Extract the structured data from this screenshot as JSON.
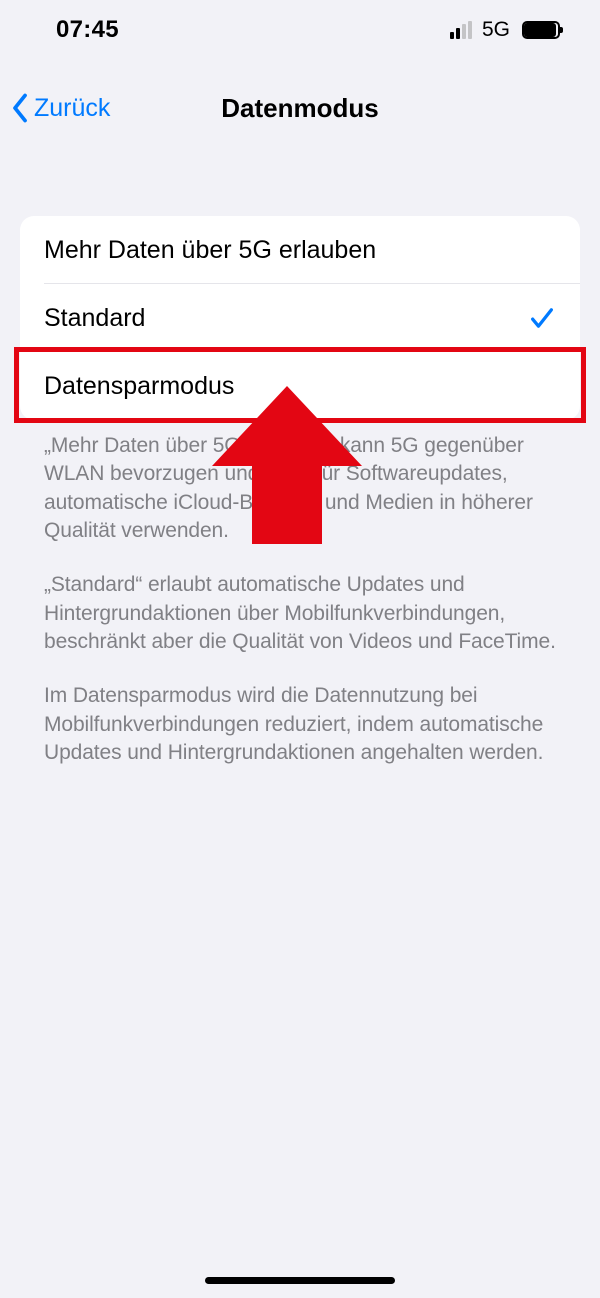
{
  "status_bar": {
    "time": "07:45",
    "network_label": "5G"
  },
  "nav": {
    "back_label": "Zurück",
    "title": "Datenmodus"
  },
  "options": {
    "allow_more_5g": "Mehr Daten über 5G erlauben",
    "standard": "Standard",
    "low_data": "Datensparmodus",
    "selected": "standard"
  },
  "footer": {
    "p1": "„Mehr Daten über 5G erlauben“ kann 5G gegenüber WLAN bevorzugen und kann für Softwareupdates, automatische iCloud-Backups und Medien in höherer Qualität verwenden.",
    "p2": "„Standard“ erlaubt automatische Updates und Hintergrundaktionen über Mobilfunkverbindungen, beschränkt aber die Qualität von Videos und FaceTime.",
    "p3": "Im Datensparmodus wird die Datennutzung bei Mobilfunkverbindungen reduziert, indem automatische Updates und Hintergrundaktionen angehalten werden."
  },
  "annotation": {
    "highlights": "low_data"
  }
}
